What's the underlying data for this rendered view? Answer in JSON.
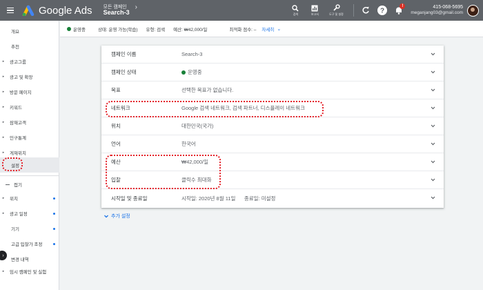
{
  "topbar": {
    "brand": "Google Ads",
    "breadcrumb_parent": "모든 캠페인",
    "breadcrumb_current": "Search-3",
    "tools": [
      {
        "icon": "search-icon",
        "label": "검색"
      },
      {
        "icon": "report-icon",
        "label": "보고서"
      },
      {
        "icon": "wrench-icon",
        "label": "도구 및 설정"
      }
    ],
    "notification_count": "!",
    "account_number": "415-068-5695",
    "account_email": "meganjang03@gmail.com"
  },
  "status": {
    "state": "운영중",
    "status_text": "상태: 운영 가능(학습)",
    "type_text": "유형: 검색",
    "budget_text": "예산: ₩42,000/일",
    "optimization_text": "최적화 점수: –",
    "details_link": "자세히"
  },
  "sidebar": {
    "items": [
      {
        "label": "개요",
        "arrow": false,
        "dot": false
      },
      {
        "label": "추천",
        "arrow": false,
        "dot": false
      },
      {
        "label": "광고그룹",
        "arrow": true,
        "dot": false
      },
      {
        "label": "광고 및 확장",
        "arrow": true,
        "dot": false
      },
      {
        "label": "방문 페이지",
        "arrow": true,
        "dot": false
      },
      {
        "label": "키워드",
        "arrow": true,
        "dot": false
      },
      {
        "label": "잠재고객",
        "arrow": true,
        "dot": false
      },
      {
        "label": "인구통계",
        "arrow": true,
        "dot": false
      },
      {
        "label": "게재위치",
        "arrow": true,
        "dot": false
      },
      {
        "label": "설정",
        "arrow": false,
        "dot": false,
        "active": true
      },
      {
        "label": "접기",
        "collapse": true
      },
      {
        "label": "위치",
        "arrow": true,
        "dot": true
      },
      {
        "label": "광고 일정",
        "arrow": true,
        "dot": true
      },
      {
        "label": "기기",
        "arrow": false,
        "dot": true
      },
      {
        "label": "고급 입찰가 조정",
        "arrow": false,
        "dot": true
      },
      {
        "label": "변경 내역",
        "arrow": false,
        "dot": false
      },
      {
        "label": "임시 캠페인 및 실험",
        "arrow": true,
        "dot": false
      }
    ]
  },
  "settings": {
    "rows": [
      {
        "label": "캠페인 이름",
        "value": "Search-3"
      },
      {
        "label": "캠페인 상태",
        "value": "운영중",
        "dot": true
      },
      {
        "label": "목표",
        "value": "선택한 목표가 없습니다."
      },
      {
        "label": "네트워크",
        "value": "Google 검색 네트워크, 검색 파트너, 디스플레이 네트워크"
      },
      {
        "label": "위치",
        "value": "대한민국(국가)"
      },
      {
        "label": "언어",
        "value": "한국어"
      },
      {
        "label": "예산",
        "value": "₩42,000/일"
      },
      {
        "label": "입찰",
        "value": "클릭수 최대화"
      },
      {
        "label": "시작일 및 종료일",
        "value": "시작일: 2020년 8월 11일      종료일: 미설정"
      }
    ],
    "more_link": "추가 설정"
  },
  "colors": {
    "topbar": "#5f6368",
    "accent": "#1a73e8",
    "status_green": "#188038",
    "annotation_red": "#e31b23"
  }
}
